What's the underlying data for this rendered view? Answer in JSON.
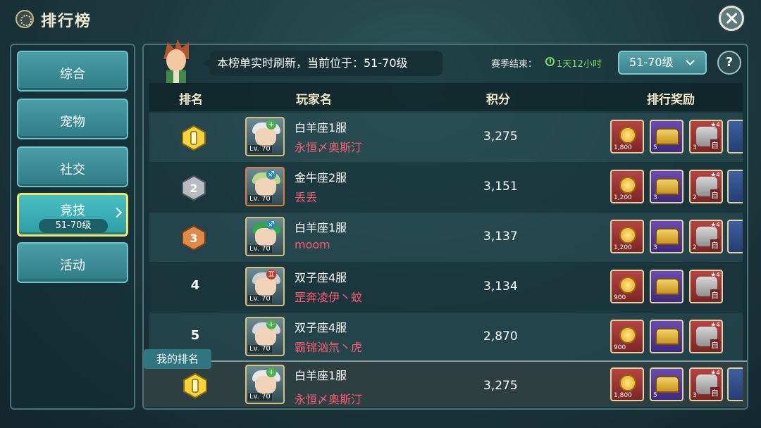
{
  "header": {
    "title": "排行榜"
  },
  "sidebar": {
    "items": [
      {
        "label": "综合"
      },
      {
        "label": "宠物"
      },
      {
        "label": "社交"
      },
      {
        "label": "竞技",
        "sub": "51-70级"
      },
      {
        "label": "活动"
      }
    ]
  },
  "info": {
    "message": "本榜单实时刷新，当前位于：51-70级",
    "season_label": "赛季结束：",
    "season_time": "1天12小时",
    "level_select": "51-70级",
    "help": "?"
  },
  "table": {
    "headers": [
      "排名",
      "玩家名",
      "积分",
      "排行奖励"
    ],
    "rows": [
      {
        "rank": "1",
        "server": "白羊座1服",
        "name": "永恒〆奥斯汀",
        "score": "3,275",
        "level": "Lv. 70",
        "rewards": [
          "1,800",
          "5",
          "3"
        ]
      },
      {
        "rank": "2",
        "server": "金牛座2服",
        "name": "丢丢",
        "score": "3,151",
        "level": "Lv. 70",
        "rewards": [
          "1,200",
          "3",
          "2"
        ]
      },
      {
        "rank": "3",
        "server": "白羊座1服",
        "name": "moom",
        "score": "3,137",
        "level": "Lv. 70",
        "rewards": [
          "1,200",
          "3",
          "2"
        ]
      },
      {
        "rank": "4",
        "server": "双子座4服",
        "name": "罡奔凌伊丶蚊",
        "score": "3,134",
        "level": "Lv. 70",
        "rewards": [
          "900",
          "",
          ""
        ]
      },
      {
        "rank": "5",
        "server": "双子座4服",
        "name": "霸锦汹氘丶虎",
        "score": "2,870",
        "level": "Lv. 70",
        "rewards": [
          "900",
          "",
          ""
        ]
      }
    ]
  },
  "my_rank": {
    "tag": "我的排名",
    "rank": "1",
    "server": "白羊座1服",
    "name": "永恒〆奥斯汀",
    "score": "3,275",
    "level": "Lv. 70",
    "rewards": [
      "1,800",
      "5",
      "3"
    ]
  },
  "reward_text": {
    "zi": "自",
    "star": "★4"
  },
  "colors": {
    "player_name": "#ff5a6e",
    "accent_gold": "#f3e56a",
    "timer_green": "#7bdc6b"
  }
}
